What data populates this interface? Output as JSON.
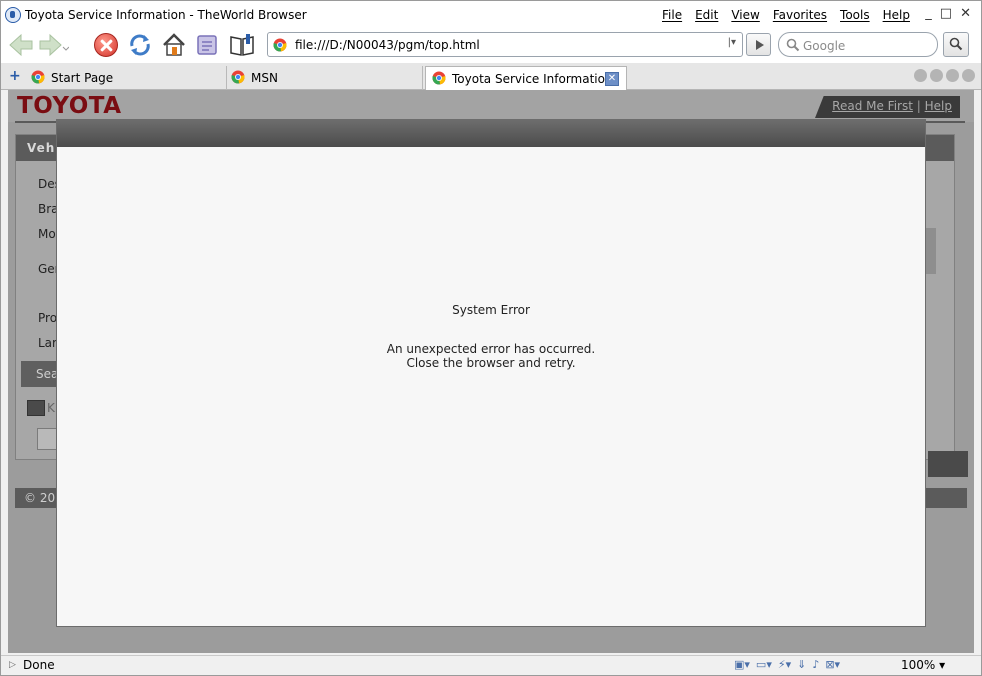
{
  "window": {
    "title": "Toyota Service Information - TheWorld Browser",
    "menu": [
      "File",
      "Edit",
      "View",
      "Favorites",
      "Tools",
      "Help"
    ],
    "controls": [
      "_",
      "□",
      "✕"
    ]
  },
  "toolbar": {
    "url": "file:///D:/N00043/pgm/top.html",
    "search_placeholder": "Google"
  },
  "tabs": [
    {
      "label": "Start Page",
      "active": false
    },
    {
      "label": "MSN",
      "active": false
    },
    {
      "label": "Toyota Service Information",
      "active": true
    }
  ],
  "page": {
    "logo_text": "TOYOTA",
    "links": {
      "read_me_first": "Read Me First",
      "separator": "|",
      "help": "Help"
    },
    "panel_header": "Veh",
    "panel_labels": [
      "Des",
      "Bra",
      "Mo",
      "Ger",
      "Pro",
      "Lar"
    ],
    "search_tab": "Sea",
    "keyword_label": "K",
    "footer_text": "© 20"
  },
  "modal": {
    "title": "System Error",
    "message_line1": "An unexpected error has occurred.",
    "message_line2": "Close the browser and retry."
  },
  "statusbar": {
    "status": "Done",
    "zoom": "100%"
  },
  "colors": {
    "toyota_red": "#7a0d12",
    "modal_header": "#5a5a5a",
    "overlay_gray": "#9c9c9c"
  }
}
